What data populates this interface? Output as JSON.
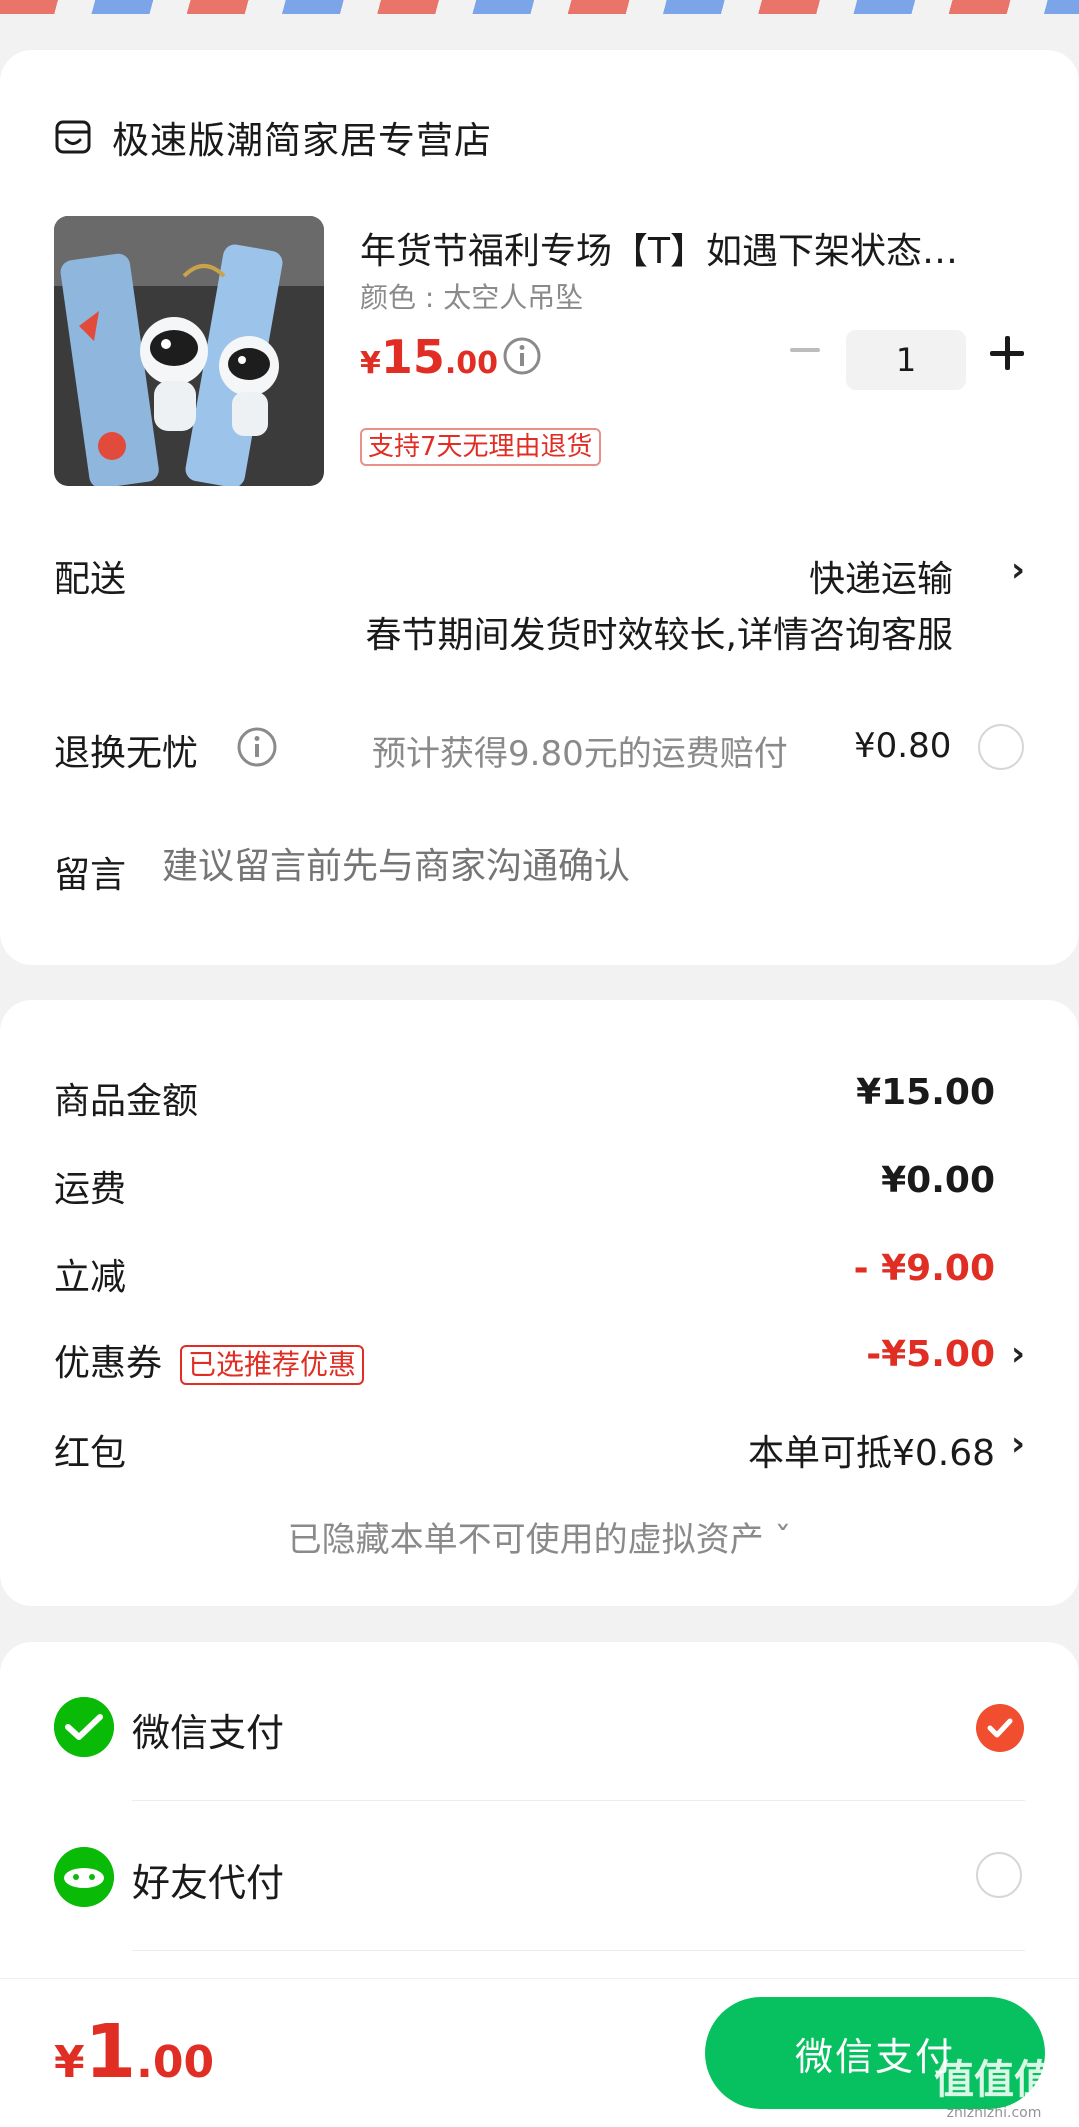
{
  "store": {
    "name": "极速版潮简家居专营店"
  },
  "product": {
    "title": "年货节福利专场【T】如遇下架状态…",
    "spec": "颜色 : 太空人吊坠",
    "price_currency": "¥",
    "price_int": "15",
    "price_dec": ".00",
    "quantity": "1",
    "return_tag": "支持7天无理由退货"
  },
  "shipping": {
    "label": "配送",
    "method": "快递运输",
    "note": "春节期间发货时效较长,详情咨询客服"
  },
  "worry_free": {
    "label": "退换无忧",
    "desc": "预计获得9.80元的运费赔付",
    "price": "¥0.80"
  },
  "message": {
    "label": "留言",
    "placeholder": "建议留言前先与商家沟通确认"
  },
  "summary": {
    "goods_label": "商品金额",
    "goods_value": "¥15.00",
    "freight_label": "运费",
    "freight_value": "¥0.00",
    "discount_label": "立减",
    "discount_value": "- ¥9.00",
    "coupon_label": "优惠券",
    "coupon_tag": "已选推荐优惠",
    "coupon_value": "-¥5.00",
    "redpacket_label": "红包",
    "redpacket_value": "本单可抵¥0.68",
    "hidden_assets": "已隐藏本单不可使用的虚拟资产 ˇ"
  },
  "payment": {
    "wechat_label": "微信支付",
    "friend_label": "好友代付",
    "selected": "wechat"
  },
  "footer": {
    "total_currency": "¥",
    "total_int": "1",
    "total_dec": ".00",
    "pay_button": "微信支付"
  },
  "watermark": {
    "big": "值值值",
    "small": "zhizhizhi.com"
  },
  "colors": {
    "accent_red": "#e02e24",
    "wechat_green": "#07c160",
    "check_orange": "#f04e2e"
  }
}
